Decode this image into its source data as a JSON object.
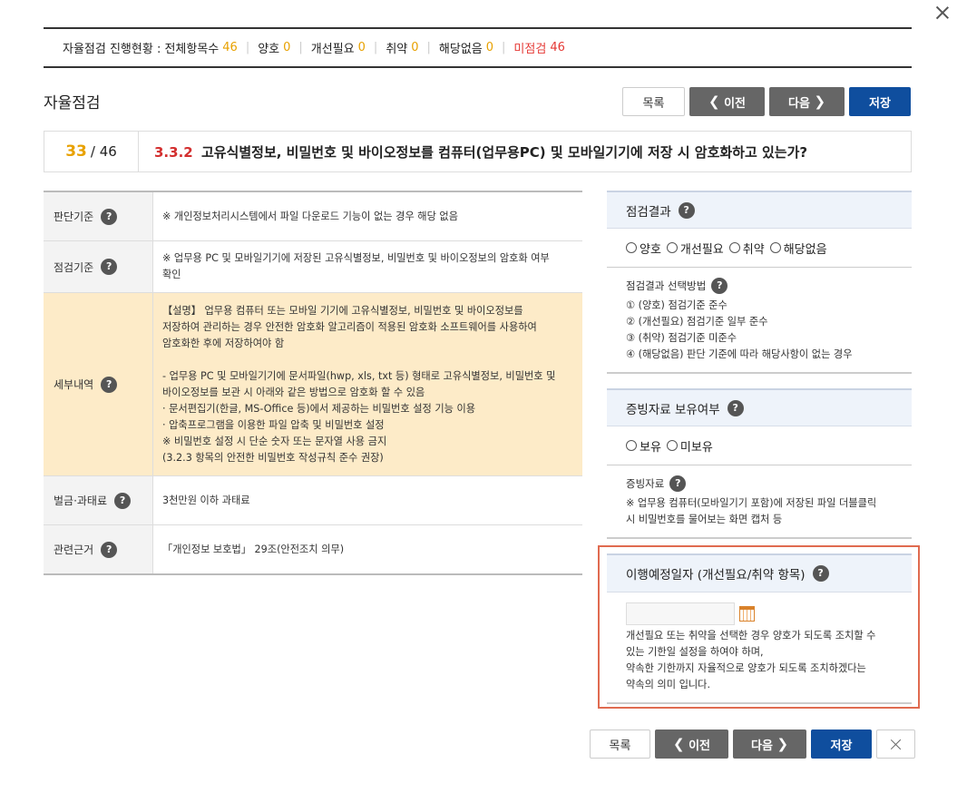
{
  "status": {
    "label": "자율점검 진행현황 : 전체항목수",
    "total": "46",
    "items": [
      {
        "label": "양호",
        "value": "0"
      },
      {
        "label": "개선필요",
        "value": "0"
      },
      {
        "label": "취약",
        "value": "0"
      },
      {
        "label": "해당없음",
        "value": "0"
      }
    ],
    "unchecked_label": "미점검",
    "unchecked_value": "46"
  },
  "page_title": "자율점검",
  "buttons": {
    "list": "목록",
    "prev": "이전",
    "next": "다음",
    "save": "저장",
    "prev_arrow": "❮",
    "next_arrow": "❯"
  },
  "question": {
    "current": "33",
    "total": "/ 46",
    "code": "3.3.2",
    "text": "고유식별정보, 비밀번호 및 바이오정보를 컴퓨터(업무용PC) 및 모바일기기에 저장 시 암호화하고 있는가?"
  },
  "help_icon": "?",
  "criteria": {
    "judgment_label": "판단기준",
    "judgment_lines": [
      "※ 개인정보처리시스템에서 파일 다운로드 기능이 없는 경우 해당 없음"
    ],
    "check_label": "점검기준",
    "check_lines": [
      "※ 업무용 PC 및 모바일기기에 저장된 고유식별정보, 비밀번호 및 바이오정보의 암호화 여부",
      "확인"
    ],
    "detail_label": "세부내역",
    "detail_lines": [
      "【설명】 업무용 컴퓨터 또는 모바일 기기에 고유식별정보, 비밀번호 및 바이오정보를",
      "저장하여 관리하는 경우 안전한 암호화 알고리즘이 적용된 암호화 소프트웨어를 사용하여",
      "암호화한 후에 저장하여야 함",
      "",
      "- 업무용 PC 및 모바일기기에 문서파일(hwp, xls, txt 등) 형태로 고유식별정보, 비밀번호 및",
      "바이오정보를 보관 시 아래와 같은 방법으로 암호화 할 수 있음",
      "· 문서편집기(한글, MS-Office 등)에서 제공하는 비밀번호 설정 기능 이용",
      "· 압축프로그램을 이용한 파일 압축 및 비밀번호 설정",
      "※ 비밀번호 설정 시 단순 숫자 또는 문자열 사용 금지",
      "(3.2.3 항목의 안전한 비밀번호 작성규칙 준수 권장)"
    ],
    "penalty_label": "벌금·과태료",
    "penalty_lines": [
      "3천만원 이하 과태료"
    ],
    "law_label": "관련근거",
    "law_lines": [
      "「개인정보 보호법」 29조(안전조치 의무)"
    ]
  },
  "result": {
    "title": "점검결과",
    "options": [
      "양호",
      "개선필요",
      "취약",
      "해당없음"
    ],
    "method_title": "점검결과 선택방법",
    "method_lines": [
      "① (양호) 점검기준 준수",
      "② (개선필요) 점검기준 일부 준수",
      "③ (취약) 점검기준 미준수",
      "④ (해당없음) 판단 기준에 따라 해당사항이 없는 경우"
    ]
  },
  "evidence": {
    "title": "증빙자료 보유여부",
    "options": [
      "보유",
      "미보유"
    ],
    "info_title": "증빙자료",
    "info_lines": [
      "※ 업무용 컴퓨터(모바일기기 포함)에 저장된 파일 더블클릭",
      "시 비밀번호를 물어보는 화면 캡처 등"
    ]
  },
  "schedule": {
    "title": "이행예정일자 (개선필요/취약 항목)",
    "date_value": "",
    "lines": [
      "개선필요 또는 취약을 선택한 경우 양호가 되도록 조치할 수",
      "있는 기한일 설정을 하여야 하며,",
      "약속한 기한까지 자율적으로 양호가 되도록 조치하겠다는",
      "약속의 의미 입니다."
    ]
  }
}
